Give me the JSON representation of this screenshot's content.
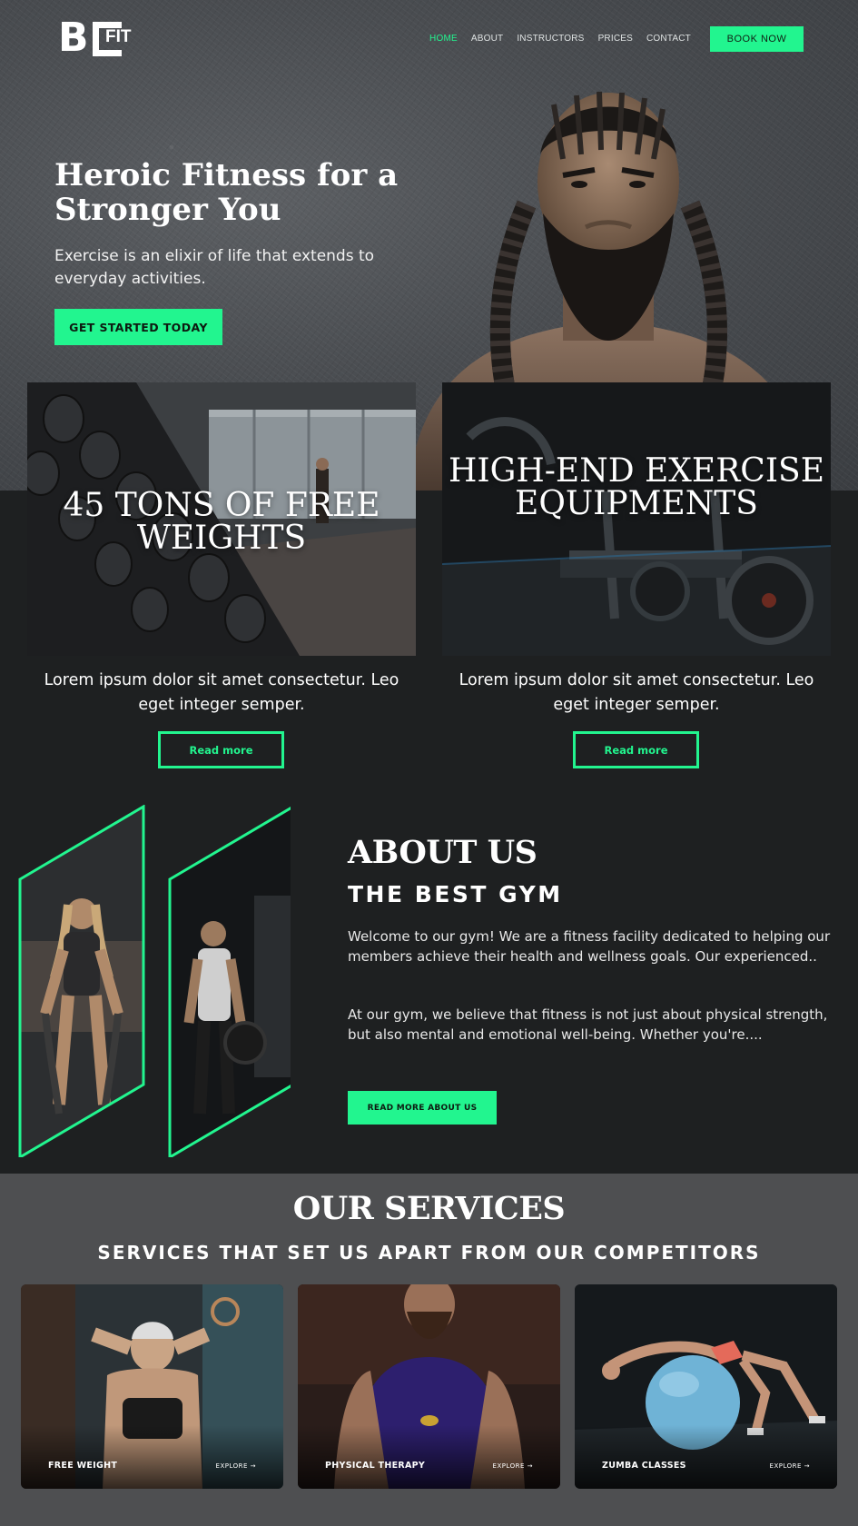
{
  "brand": {
    "logo_main": "B",
    "logo_sub": "FIT"
  },
  "nav": {
    "items": [
      {
        "label": "HOME",
        "active": true
      },
      {
        "label": "ABOUT",
        "active": false
      },
      {
        "label": "INSTRUCTORS",
        "active": false
      },
      {
        "label": "PRICES",
        "active": false
      },
      {
        "label": "CONTACT",
        "active": false
      }
    ],
    "book_label": "BOOK NOW"
  },
  "hero": {
    "title": "Heroic Fitness for a Stronger You",
    "subtitle": "Exercise is an elixir of life that extends to everyday activities.",
    "cta_label": "GET STARTED TODAY"
  },
  "features": [
    {
      "title": "45 TONS OF FREE WEIGHTS",
      "description": "Lorem ipsum dolor sit amet consectetur. Leo eget integer semper.",
      "button": "Read more"
    },
    {
      "title": "HIGH-END EXERCISE EQUIPMENTS",
      "description": "Lorem ipsum dolor sit amet consectetur. Leo eget integer semper.",
      "button": "Read more"
    }
  ],
  "about": {
    "title": "ABOUT US",
    "subtitle": "THE BEST GYM",
    "paragraph1": "Welcome to our gym! We are a fitness facility dedicated to helping our members achieve their health and wellness goals. Our experienced..",
    "paragraph2": "At our gym, we believe that fitness is not just about physical strength, but also mental and emotional well-being. Whether you're....",
    "button": "READ MORE ABOUT US"
  },
  "services": {
    "title": "OUR SERVICES",
    "subtitle": "SERVICES THAT SET US APART FROM OUR COMPETITORS",
    "cards": [
      {
        "label": "FREE WEIGHT",
        "explore": "EXPLORE →"
      },
      {
        "label": "PHYSICAL THERAPY",
        "explore": "EXPLORE →"
      },
      {
        "label": "ZUMBA CLASSES",
        "explore": "EXPLORE →"
      }
    ]
  },
  "colors": {
    "accent": "#22f58f",
    "dark_bg": "#1e2021",
    "services_bg": "#4e4f51"
  }
}
